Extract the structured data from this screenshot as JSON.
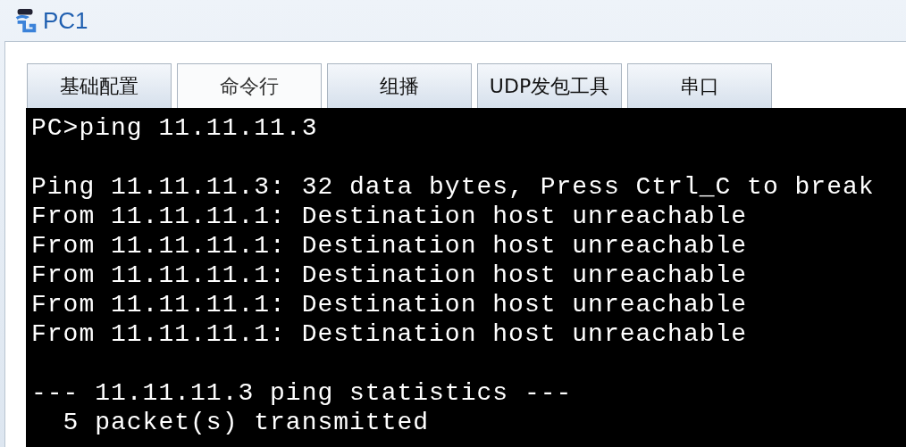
{
  "window": {
    "title": "PC1"
  },
  "tabs": [
    {
      "label": "基础配置",
      "selected": false
    },
    {
      "label": "命令行",
      "selected": true
    },
    {
      "label": "组播",
      "selected": false
    },
    {
      "label": "UDP发包工具",
      "selected": false
    },
    {
      "label": "串口",
      "selected": false
    }
  ],
  "terminal": {
    "blocks": [
      [
        "PC>ping 11.11.11.3"
      ],
      [
        "Ping 11.11.11.3: 32 data bytes, Press Ctrl_C to break",
        "From 11.11.11.1: Destination host unreachable",
        "From 11.11.11.1: Destination host unreachable",
        "From 11.11.11.1: Destination host unreachable",
        "From 11.11.11.1: Destination host unreachable",
        "From 11.11.11.1: Destination host unreachable"
      ],
      [
        "--- 11.11.11.3 ping statistics ---",
        "  5 packet(s) transmitted"
      ]
    ]
  }
}
